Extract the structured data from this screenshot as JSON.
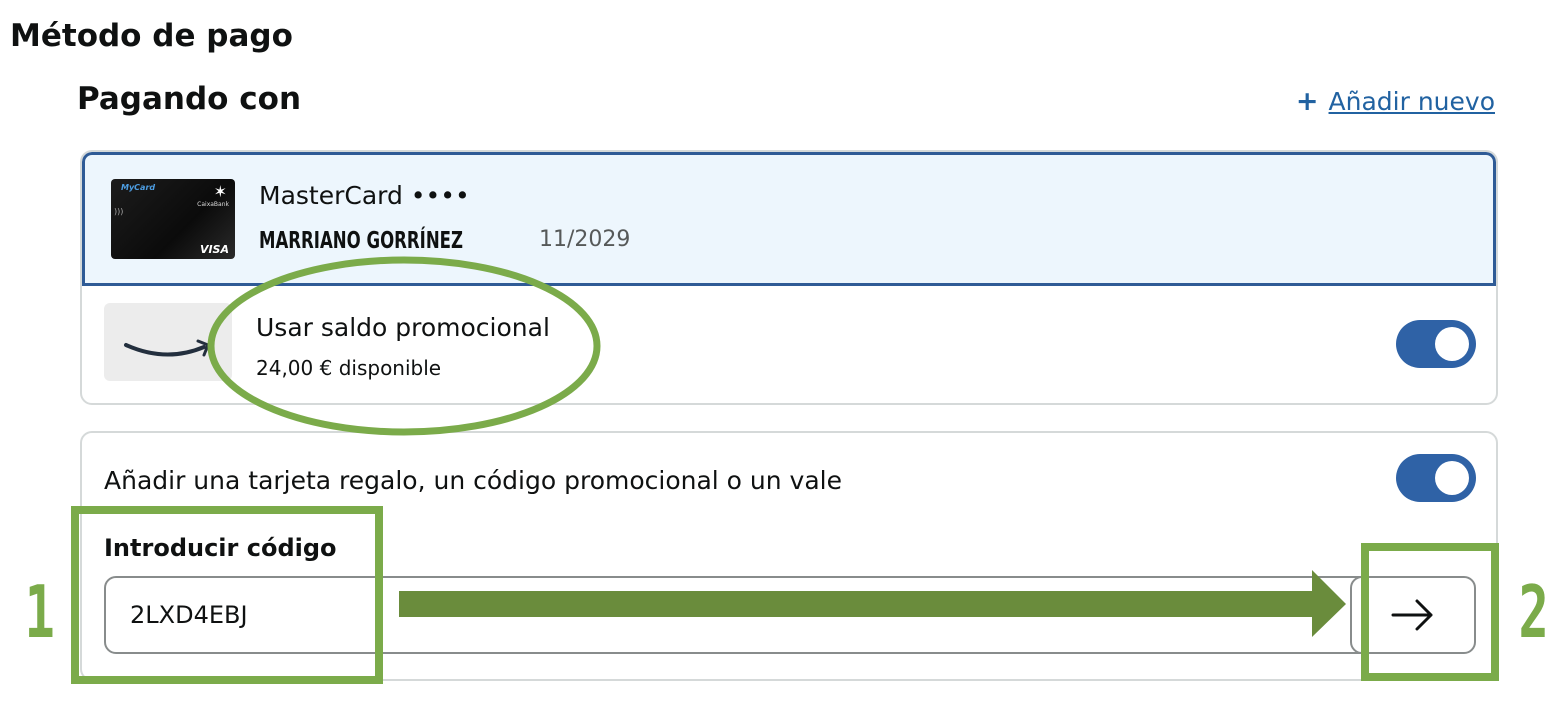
{
  "section": {
    "title": "Método de pago"
  },
  "paying": {
    "title": "Pagando con",
    "add_new_icon": "+",
    "add_new_label": "Añadir nuevo"
  },
  "card": {
    "image_label_mycard": "MyCard",
    "image_label_bank": "CaixaBank",
    "image_label_network": "VISA",
    "brand": "MasterCard ••••",
    "holder": "MARRIANO GORRÍNEZ",
    "expiry": "11/2029"
  },
  "promo_balance": {
    "label": "Usar saldo promocional",
    "available": "24,00 € disponible",
    "toggle_on": true,
    "logo_icon": "amazon-smile-icon"
  },
  "gift": {
    "label": "Añadir una tarjeta regalo, un código promocional o un vale",
    "toggle_on": true,
    "code_title": "Introducir código",
    "code_value": "2LXD4EBJ",
    "submit_icon": "arrow-right-icon"
  },
  "annotations": {
    "step1": "1",
    "step2": "2",
    "color": "#7bab4a",
    "arrow_color": "#6a8c3c"
  },
  "colors": {
    "link": "#2162a1",
    "toggle": "#2f62a6",
    "selected_bg": "#edf6fd",
    "selected_border": "#2f5b96"
  }
}
